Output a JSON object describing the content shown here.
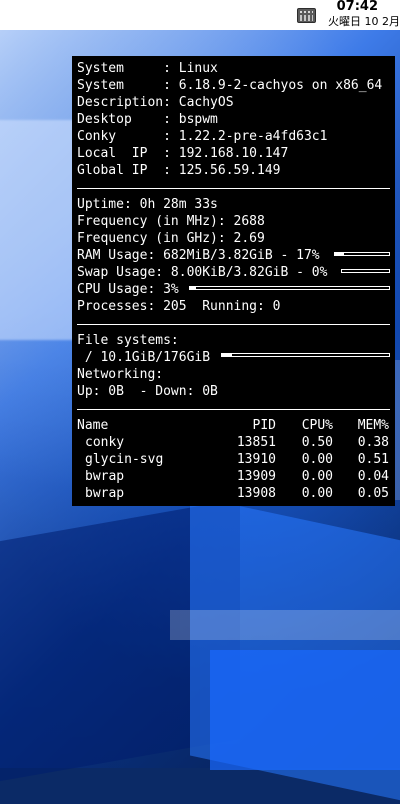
{
  "topbar": {
    "time": "07:42",
    "date": "火曜日 10 2月",
    "keyboard_icon": "keyboard-icon"
  },
  "conky": {
    "system_lines": [
      "System     : Linux",
      "System     : 6.18.9-2-cachyos on x86_64",
      "Description: CachyOS",
      "Desktop    : bspwm",
      "Conky      : 1.22.2-pre-a4fd63c1",
      "Local  IP  : 192.168.10.147",
      "Global IP  : 125.56.59.149"
    ],
    "metrics": {
      "uptime": "Uptime: 0h 28m 33s",
      "freq_mhz": "Frequency (in MHz): 2688",
      "freq_ghz": "Frequency (in GHz): 2.69",
      "ram": "RAM Usage: 682MiB/3.82GiB - 17%",
      "swap": "Swap Usage: 8.00KiB/3.82GiB - 0%",
      "cpu": "CPU Usage: 3%",
      "processes": "Processes: 205  Running: 0"
    },
    "bars": {
      "ram_percent": 17,
      "swap_percent": 0,
      "cpu_percent": 3,
      "fs_percent": 6
    },
    "filesystems": {
      "label": "File systems:",
      "root": " / 10.1GiB/176GiB",
      "networking_label": "Networking:",
      "net_line": "Up: 0B  - Down: 0B"
    },
    "processes_table": {
      "headers": [
        "Name",
        "PID",
        "CPU%",
        "MEM%"
      ],
      "rows": [
        {
          "name": "conky",
          "pid": "13851",
          "cpu": "0.50",
          "mem": "0.38"
        },
        {
          "name": "glycin-svg",
          "pid": "13910",
          "cpu": "0.00",
          "mem": "0.51"
        },
        {
          "name": "bwrap",
          "pid": "13909",
          "cpu": "0.00",
          "mem": "0.04"
        },
        {
          "name": "bwrap",
          "pid": "13908",
          "cpu": "0.00",
          "mem": "0.05"
        }
      ]
    }
  }
}
